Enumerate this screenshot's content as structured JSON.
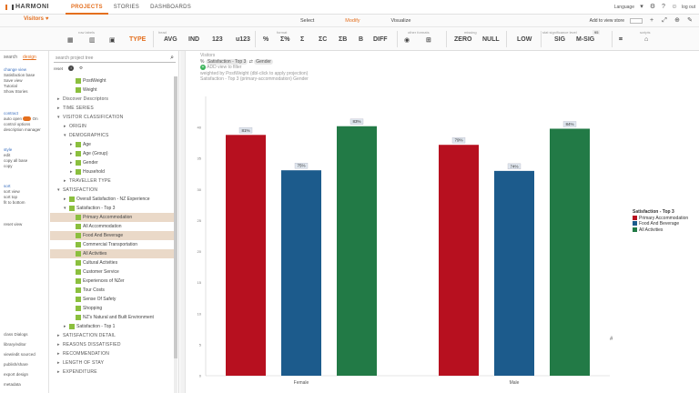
{
  "app": {
    "name": "HARMONI"
  },
  "nav": {
    "items": [
      "PROJECTS",
      "STORIES",
      "DASHBOARDS"
    ],
    "active": 0
  },
  "top_right": {
    "language": "Language",
    "logout": "log out"
  },
  "study": {
    "title": "Visitors"
  },
  "modes": {
    "items": [
      "Select",
      "Modify",
      "Visualize"
    ],
    "active": 1
  },
  "mode_right": {
    "add_view": "Add to view store",
    "zoom": "100%"
  },
  "toolbar": {
    "groups": [
      "row labels",
      "head",
      "format",
      "other formats",
      "missing",
      "stat significance level",
      "scripts"
    ],
    "buttons": [
      "TYPE",
      "AVG",
      "IND",
      "123",
      "u123",
      "%",
      "Σ%",
      "Σ",
      "ΣC",
      "ΣB",
      "B",
      "DIFF",
      "ZERO",
      "NULL",
      "LOW",
      "SIG",
      "M-SIG"
    ],
    "active_button": "TYPE",
    "sig_level": "95"
  },
  "left_tabs": [
    "search",
    "design"
  ],
  "left_panel": {
    "section1": [
      "change view",
      "Satisfaction base",
      "Save view",
      "Tutorial",
      "Show Stories"
    ],
    "section2_title": "contract",
    "section2": [
      "auto open",
      "control options",
      "description manager"
    ],
    "section3": [
      "style",
      "edit",
      "copy all base",
      "copy"
    ],
    "section4_title": "sort",
    "section4": [
      "sort view",
      "sort top",
      "fit to bottom"
    ],
    "section5": [
      "reset view"
    ],
    "bottom": [
      "class Dialogs",
      "library/editor",
      "view/edit sourced",
      "publish/share",
      "export design",
      "metadata"
    ],
    "on_label": "On"
  },
  "tree": {
    "search_placeholder": "search project tree",
    "tools": [
      "reset",
      "i",
      "⚙"
    ],
    "rows": [
      {
        "label": "PostWeight",
        "level": 2,
        "type": "var"
      },
      {
        "label": "Weight",
        "level": 2,
        "type": "var"
      },
      {
        "label": "Discover Descriptors",
        "level": 0,
        "type": "group"
      },
      {
        "label": "TIME SERIES",
        "level": 0,
        "type": "group"
      },
      {
        "label": "VISITOR CLASSIFICATION",
        "level": 0,
        "type": "group",
        "open": true
      },
      {
        "label": "ORIGIN",
        "level": 1,
        "type": "group"
      },
      {
        "label": "DEMOGRAPHICS",
        "level": 1,
        "type": "group",
        "open": true
      },
      {
        "label": "Age",
        "level": 2,
        "type": "var"
      },
      {
        "label": "Age (Group)",
        "level": 2,
        "type": "var"
      },
      {
        "label": "Gender",
        "level": 2,
        "type": "var"
      },
      {
        "label": "Household",
        "level": 2,
        "type": "var"
      },
      {
        "label": "TRAVELLER TYPE",
        "level": 1,
        "type": "group"
      },
      {
        "label": "SATISFACTION",
        "level": 0,
        "type": "group",
        "open": true
      },
      {
        "label": "Overall Satisfaction - NZ Experience",
        "level": 1,
        "type": "var"
      },
      {
        "label": "Satisfaction - Top 3",
        "level": 1,
        "type": "var",
        "open": true
      },
      {
        "label": "Primary Accommodation",
        "level": 2,
        "type": "var",
        "hl": true
      },
      {
        "label": "All Accommodation",
        "level": 2,
        "type": "var"
      },
      {
        "label": "Food And Beverage",
        "level": 2,
        "type": "var",
        "hl": true
      },
      {
        "label": "Commercial Transportation",
        "level": 2,
        "type": "var"
      },
      {
        "label": "All Activities",
        "level": 2,
        "type": "var",
        "hl": true
      },
      {
        "label": "Cultural Activities",
        "level": 2,
        "type": "var"
      },
      {
        "label": "Customer Service",
        "level": 2,
        "type": "var"
      },
      {
        "label": "Experiences of NZer",
        "level": 2,
        "type": "var"
      },
      {
        "label": "Tour Costs",
        "level": 2,
        "type": "var"
      },
      {
        "label": "Sense Of Safety",
        "level": 2,
        "type": "var"
      },
      {
        "label": "Shopping",
        "level": 2,
        "type": "var"
      },
      {
        "label": "NZ's Natural and Built Environment",
        "level": 2,
        "type": "var"
      },
      {
        "label": "Satisfaction - Top 1",
        "level": 1,
        "type": "var"
      },
      {
        "label": "SATISFACTION DETAIL",
        "level": 0,
        "type": "group"
      },
      {
        "label": "REASONS DISSATISFIED",
        "level": 0,
        "type": "group"
      },
      {
        "label": "RECOMMENDATION",
        "level": 0,
        "type": "group"
      },
      {
        "label": "LENGTH OF STAY",
        "level": 0,
        "type": "group"
      },
      {
        "label": "EXPENDITURE",
        "level": 0,
        "type": "group"
      }
    ]
  },
  "crumbs": {
    "line1": "Visitors",
    "line2_a": "Satisfaction - Top 3",
    "line2_b": "Gender",
    "line3": "ADD view to filter",
    "line4": "weighted by PostWeight  (dbl-click to apply projection)",
    "line5": "Satisfaction - Top 3  (primary-accommodation)  Gender"
  },
  "colors": {
    "accent": "#e46f1e",
    "red": "#b7101f",
    "blue": "#1c5b8c",
    "green": "#227a46"
  },
  "chart_data": {
    "type": "bar",
    "categories": [
      "Female",
      "Male"
    ],
    "ylim": [
      0,
      45
    ],
    "yticks": [
      0,
      5,
      10,
      15,
      20,
      25,
      30,
      35,
      40
    ],
    "legend_title": "Satisfaction - Top 3",
    "series": [
      {
        "name": "Primary Accommodation",
        "values": [
          38.8,
          37.2
        ],
        "labels": [
          "81%",
          "79%"
        ],
        "color": "#b7101f"
      },
      {
        "name": "Food And Beverage",
        "values": [
          33.1,
          33.0
        ],
        "labels": [
          "75%",
          "74%"
        ],
        "color": "#1c5b8c"
      },
      {
        "name": "All Activities",
        "values": [
          40.2,
          39.8
        ],
        "labels": [
          "83%",
          "84%"
        ],
        "color": "#227a46"
      }
    ]
  },
  "misc": {
    "hash": "#"
  }
}
